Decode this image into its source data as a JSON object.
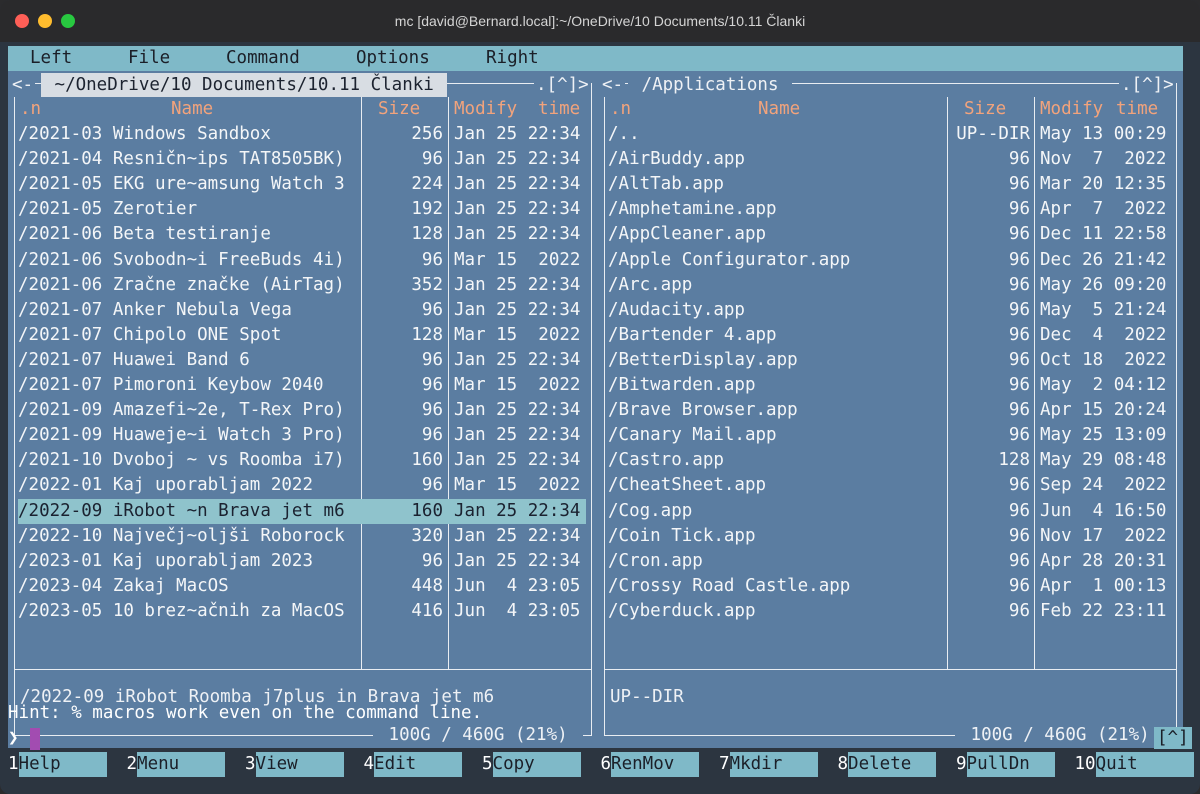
{
  "window": {
    "title": "mc [david@Bernard.local]:~/OneDrive/10 Documents/10.11 Članki"
  },
  "menubar": [
    "Left",
    "File",
    "Command",
    "Options",
    "Right"
  ],
  "left_panel": {
    "path": " ~/OneDrive/10 Documents/10.11 Članki ",
    "corner_left": "<-",
    "corner_right": ".[^]>",
    "headers": {
      "n": ".n",
      "name": "Name",
      "size": "Size",
      "modify": "Modify",
      "time": "time"
    },
    "rows": [
      {
        "name": "/2021-03 Windows Sandbox",
        "size": "256",
        "date": "Jan 25 22:34"
      },
      {
        "name": "/2021-04 Resničn~ips TAT8505BK)",
        "size": "96",
        "date": "Jan 25 22:34"
      },
      {
        "name": "/2021-05 EKG ure~amsung Watch 3",
        "size": "224",
        "date": "Jan 25 22:34"
      },
      {
        "name": "/2021-05 Zerotier",
        "size": "192",
        "date": "Jan 25 22:34"
      },
      {
        "name": "/2021-06 Beta testiranje",
        "size": "128",
        "date": "Jan 25 22:34"
      },
      {
        "name": "/2021-06 Svobodn~i FreeBuds 4i)",
        "size": "96",
        "date": "Mar 15  2022"
      },
      {
        "name": "/2021-06 Zračne značke (AirTag)",
        "size": "352",
        "date": "Jan 25 22:34"
      },
      {
        "name": "/2021-07 Anker Nebula Vega",
        "size": "96",
        "date": "Jan 25 22:34"
      },
      {
        "name": "/2021-07 Chipolo ONE Spot",
        "size": "128",
        "date": "Mar 15  2022"
      },
      {
        "name": "/2021-07 Huawei Band 6",
        "size": "96",
        "date": "Jan 25 22:34"
      },
      {
        "name": "/2021-07 Pimoroni Keybow 2040",
        "size": "96",
        "date": "Mar 15  2022"
      },
      {
        "name": "/2021-09 Amazefi~2e, T-Rex Pro)",
        "size": "96",
        "date": "Jan 25 22:34"
      },
      {
        "name": "/2021-09 Huaweje~i Watch 3 Pro)",
        "size": "96",
        "date": "Jan 25 22:34"
      },
      {
        "name": "/2021-10 Dvoboj ~ vs Roomba i7)",
        "size": "160",
        "date": "Jan 25 22:34"
      },
      {
        "name": "/2022-01 Kaj uporabljam 2022",
        "size": "96",
        "date": "Mar 15  2022"
      },
      {
        "name": "/2022-09 iRobot ~n Brava jet m6",
        "size": "160",
        "date": "Jan 25 22:34",
        "selected": true
      },
      {
        "name": "/2022-10 Največj~oljši Roborock",
        "size": "320",
        "date": "Jan 25 22:34"
      },
      {
        "name": "/2023-01 Kaj uporabljam 2023",
        "size": "96",
        "date": "Jan 25 22:34"
      },
      {
        "name": "/2023-04 Zakaj MacOS",
        "size": "448",
        "date": "Jun  4 23:05"
      },
      {
        "name": "/2023-05 10 brez~ačnih za MacOS",
        "size": "416",
        "date": "Jun  4 23:05"
      }
    ],
    "mini_status": "/2022-09 iRobot Roomba j7plus in Brava jet m6",
    "disk": " 100G / 460G (21%) "
  },
  "right_panel": {
    "corner_left": "<-",
    "path": " /Applications ",
    "corner_right": ".[^]>",
    "headers": {
      "n": ".n",
      "name": "Name",
      "size": "Size",
      "modify": "Modify",
      "time": "time"
    },
    "rows": [
      {
        "name": "/..",
        "size": "UP--DIR",
        "date": "May 13 00:29"
      },
      {
        "name": "/AirBuddy.app",
        "size": "96",
        "date": "Nov  7  2022"
      },
      {
        "name": "/AltTab.app",
        "size": "96",
        "date": "Mar 20 12:35"
      },
      {
        "name": "/Amphetamine.app",
        "size": "96",
        "date": "Apr  7  2022"
      },
      {
        "name": "/AppCleaner.app",
        "size": "96",
        "date": "Dec 11 22:58"
      },
      {
        "name": "/Apple Configurator.app",
        "size": "96",
        "date": "Dec 26 21:42"
      },
      {
        "name": "/Arc.app",
        "size": "96",
        "date": "May 26 09:20"
      },
      {
        "name": "/Audacity.app",
        "size": "96",
        "date": "May  5 21:24"
      },
      {
        "name": "/Bartender 4.app",
        "size": "96",
        "date": "Dec  4  2022"
      },
      {
        "name": "/BetterDisplay.app",
        "size": "96",
        "date": "Oct 18  2022"
      },
      {
        "name": "/Bitwarden.app",
        "size": "96",
        "date": "May  2 04:12"
      },
      {
        "name": "/Brave Browser.app",
        "size": "96",
        "date": "Apr 15 20:24"
      },
      {
        "name": "/Canary Mail.app",
        "size": "96",
        "date": "May 25 13:09"
      },
      {
        "name": "/Castro.app",
        "size": "128",
        "date": "May 29 08:48"
      },
      {
        "name": "/CheatSheet.app",
        "size": "96",
        "date": "Sep 24  2022"
      },
      {
        "name": "/Cog.app",
        "size": "96",
        "date": "Jun  4 16:50"
      },
      {
        "name": "/Coin Tick.app",
        "size": "96",
        "date": "Nov 17  2022"
      },
      {
        "name": "/Cron.app",
        "size": "96",
        "date": "Apr 28 20:31"
      },
      {
        "name": "/Crossy Road Castle.app",
        "size": "96",
        "date": "Apr  1 00:13"
      },
      {
        "name": "/Cyberduck.app",
        "size": "96",
        "date": "Feb 22 23:11"
      }
    ],
    "mini_status": "UP--DIR",
    "disk": " 100G / 460G (21%) "
  },
  "hint": "Hint: % macros work even on the command line.",
  "prompt": "❯",
  "history_button": "[^]",
  "fkeys": [
    {
      "num": "1",
      "label": "Help"
    },
    {
      "num": "2",
      "label": "Menu"
    },
    {
      "num": "3",
      "label": "View"
    },
    {
      "num": "4",
      "label": "Edit"
    },
    {
      "num": "5",
      "label": "Copy"
    },
    {
      "num": "6",
      "label": "RenMov"
    },
    {
      "num": "7",
      "label": "Mkdir"
    },
    {
      "num": "8",
      "label": "Delete"
    },
    {
      "num": "9",
      "label": "PullDn"
    },
    {
      "num": "10",
      "label": "Quit"
    }
  ],
  "colors": {
    "panel_bg": "#5b7da1",
    "menubar_bg": "#7fb9c8",
    "header_fg": "#f2a37c",
    "selection_bg": "#8fc3cc",
    "cursor": "#a24cb1"
  }
}
